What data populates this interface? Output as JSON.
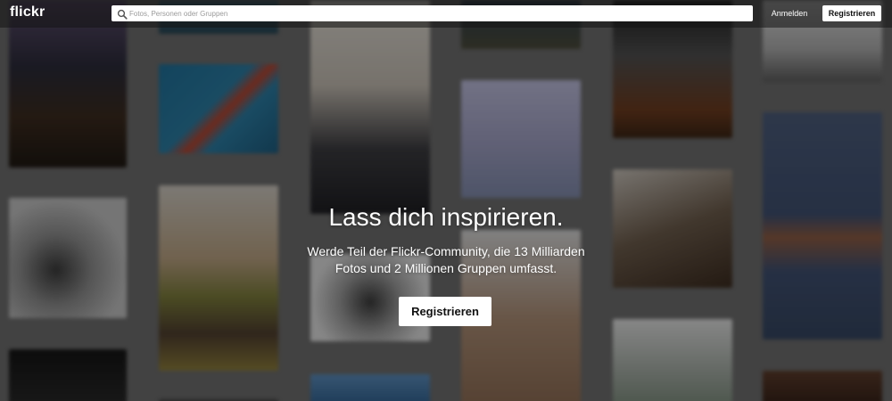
{
  "header": {
    "logo_text": "flickr",
    "search": {
      "placeholder": "Fotos, Personen oder Gruppen",
      "value": ""
    },
    "login_label": "Anmelden",
    "signup_label": "Registrieren"
  },
  "hero": {
    "title": "Lass dich inspirieren.",
    "subtitle_line1": "Werde Teil der Flickr-Community, die 13 Milliarden",
    "subtitle_line2": "Fotos und 2 Millionen Gruppen umfasst.",
    "cta_label": "Registrieren"
  },
  "colors": {
    "header_bg": "#141414",
    "button_bg": "#ffffff",
    "button_text": "#111111",
    "text_light": "#ffffff"
  },
  "icons": {
    "search": "search-icon"
  }
}
